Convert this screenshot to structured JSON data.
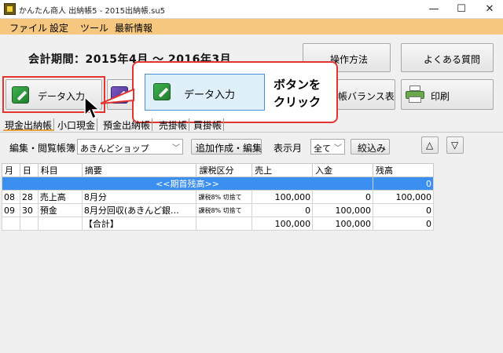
{
  "window": {
    "title": "かんたん商人 出納帳5 - 2015出納帳.su5",
    "minimize": "—",
    "maximize": "☐",
    "close": "✕"
  },
  "menu": [
    "ファイル",
    "設定",
    "ツール",
    "最新情報"
  ],
  "period": "会計期間：2015年4月 〜 2016年3月",
  "buttons": {
    "data_entry": "データ入力",
    "howto": "操作方法",
    "faq": "よくある質問",
    "balance": "帳バランス表",
    "print": "印刷"
  },
  "callout": {
    "button_label": "データ入力",
    "instruction_line1": "ボタンを",
    "instruction_line2": "クリック"
  },
  "tabs": [
    "現金出納帳",
    "小口現金",
    "預金出納帳",
    "売掛帳",
    "買掛帳"
  ],
  "filters": {
    "book_label": "編集・閲覧帳簿",
    "book_value": "あきんどショップ",
    "add_edit": "追加作成・編集",
    "month_label": "表示月",
    "month_value": "全て",
    "narrow": "絞込み",
    "up": "△",
    "down": "▽"
  },
  "table": {
    "headers": [
      "月",
      "日",
      "科目",
      "摘要",
      "課税区分",
      "売上",
      "入金",
      "残高"
    ],
    "opening_label": "<<期首残高>>",
    "opening_balance": "0",
    "rows": [
      [
        "08",
        "28",
        "売上高",
        "8月分",
        "課税8% 切捨て",
        "100,000",
        "0",
        "100,000"
      ],
      [
        "09",
        "30",
        "預金",
        "8月分回収(あきんど銀…",
        "課税8% 切捨て",
        "0",
        "100,000",
        "0"
      ]
    ],
    "total": [
      "",
      "",
      "",
      "【合計】",
      "",
      "100,000",
      "100,000",
      "0"
    ]
  },
  "colors": {
    "menubar": "#f6c77f",
    "highlight": "#e3342f",
    "opening_row": "#3b8ff0"
  }
}
